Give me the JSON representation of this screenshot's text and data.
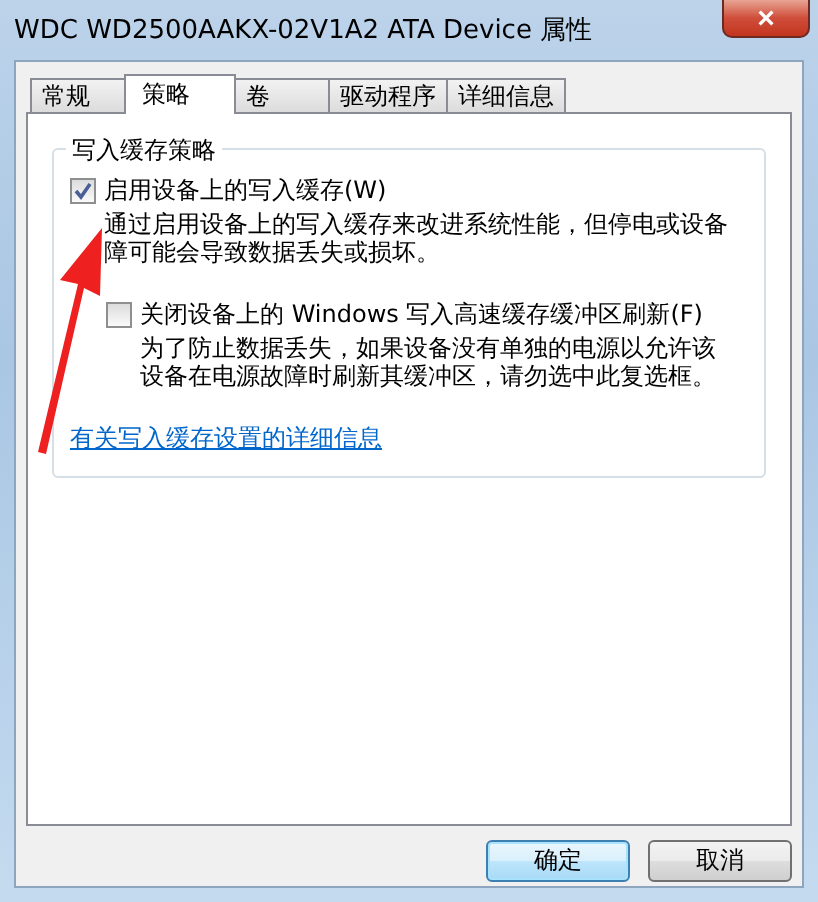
{
  "window": {
    "title": "WDC WD2500AAKX-02V1A2 ATA Device 属性",
    "close": "×"
  },
  "tabs": [
    {
      "label": "常规",
      "selected": false
    },
    {
      "label": "策略",
      "selected": true
    },
    {
      "label": "卷",
      "selected": false
    },
    {
      "label": "驱动程序",
      "selected": false
    },
    {
      "label": "详细信息",
      "selected": false
    }
  ],
  "group": {
    "title": "写入缓存策略",
    "options": [
      {
        "label": "启用设备上的写入缓存(W)",
        "checked": true,
        "description": "通过启用设备上的写入缓存来改进系统性能，但停电或设备障可能会导致数据丢失或损坏。",
        "indent": false
      },
      {
        "label": "关闭设备上的 Windows 写入高速缓存缓冲区刷新(F)",
        "checked": false,
        "description": "为了防止数据丢失，如果设备没有单独的电源以允许该设备在电源故障时刷新其缓冲区，请勿选中此复选框。",
        "indent": true
      }
    ],
    "link": "有关写入缓存设置的详细信息"
  },
  "buttons": [
    {
      "label": "确定",
      "default": true
    },
    {
      "label": "取消",
      "default": false
    }
  ]
}
